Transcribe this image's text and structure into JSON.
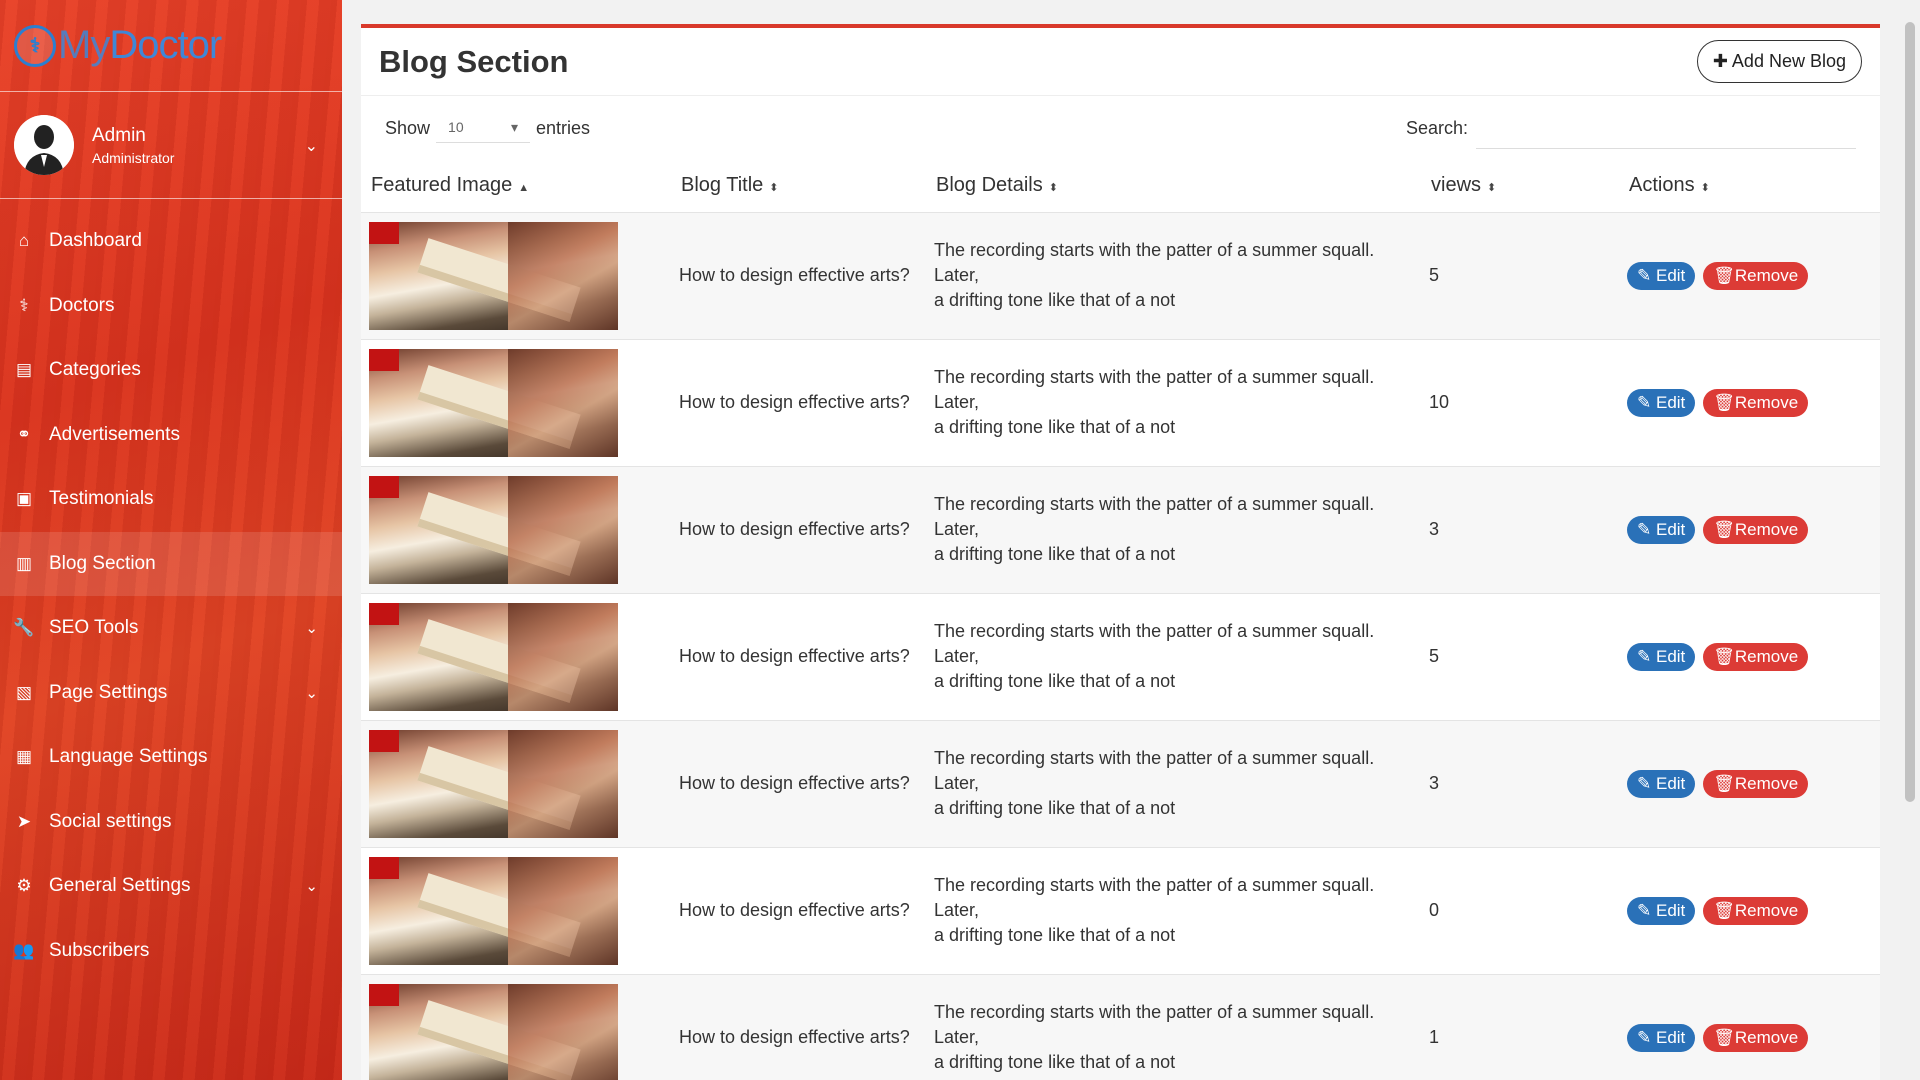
{
  "brand": {
    "logo_icon": "stethoscope-icon",
    "name_prefix": "My",
    "name_suffix": "Doctor"
  },
  "user": {
    "name": "Admin",
    "role": "Administrator"
  },
  "sidebar": {
    "items": [
      {
        "label": "Dashboard",
        "icon": "home-icon",
        "glyph": "⌂"
      },
      {
        "label": "Doctors",
        "icon": "user-md-icon",
        "glyph": "⚕"
      },
      {
        "label": "Categories",
        "icon": "list-alt-icon",
        "glyph": "▤"
      },
      {
        "label": "Advertisements",
        "icon": "link-icon",
        "glyph": "⚭"
      },
      {
        "label": "Testimonials",
        "icon": "image-icon",
        "glyph": "▣"
      },
      {
        "label": "Blog Section",
        "icon": "file-text-icon",
        "glyph": "▥"
      },
      {
        "label": "SEO Tools",
        "icon": "wrench-icon",
        "glyph": "🔧"
      },
      {
        "label": "Page Settings",
        "icon": "file-code-icon",
        "glyph": "▧"
      },
      {
        "label": "Language Settings",
        "icon": "language-icon",
        "glyph": "▦"
      },
      {
        "label": "Social settings",
        "icon": "paper-plane-icon",
        "glyph": "➤"
      },
      {
        "label": "General Settings",
        "icon": "cogs-icon",
        "glyph": "⚙"
      },
      {
        "label": "Subscribers",
        "icon": "users-icon",
        "glyph": "👥"
      }
    ]
  },
  "page": {
    "title": "Blog Section",
    "add_button": "Add New Blog"
  },
  "table_controls": {
    "show_label": "Show",
    "entries_value": "10",
    "entries_label": "entries",
    "search_label": "Search:"
  },
  "columns": [
    "Featured Image",
    "Blog Title",
    "Blog Details",
    "views",
    "Actions"
  ],
  "rows": [
    {
      "title": "How to design effective arts?",
      "details_line1": "The recording starts with the patter of a summer squall. Later,",
      "details_line2": "a drifting tone like that of a not",
      "views": "5",
      "edit": "Edit",
      "remove": "Remove"
    },
    {
      "title": "How to design effective arts?",
      "details_line1": "The recording starts with the patter of a summer squall. Later,",
      "details_line2": "a drifting tone like that of a not",
      "views": "10",
      "edit": "Edit",
      "remove": "Remove"
    },
    {
      "title": "How to design effective arts?",
      "details_line1": "The recording starts with the patter of a summer squall. Later,",
      "details_line2": "a drifting tone like that of a not",
      "views": "3",
      "edit": "Edit",
      "remove": "Remove"
    },
    {
      "title": "How to design effective arts?",
      "details_line1": "The recording starts with the patter of a summer squall. Later,",
      "details_line2": "a drifting tone like that of a not",
      "views": "5",
      "edit": "Edit",
      "remove": "Remove"
    },
    {
      "title": "How to design effective arts?",
      "details_line1": "The recording starts with the patter of a summer squall. Later,",
      "details_line2": "a drifting tone like that of a not",
      "views": "3",
      "edit": "Edit",
      "remove": "Remove"
    },
    {
      "title": "How to design effective arts?",
      "details_line1": "The recording starts with the patter of a summer squall. Later,",
      "details_line2": "a drifting tone like that of a not",
      "views": "0",
      "edit": "Edit",
      "remove": "Remove"
    },
    {
      "title": "How to design effective arts?",
      "details_line1": "The recording starts with the patter of a summer squall. Later,",
      "details_line2": "a drifting tone like that of a not",
      "views": "1",
      "edit": "Edit",
      "remove": "Remove"
    }
  ],
  "colors": {
    "accent": "#d9392b",
    "edit": "#2a71b8",
    "remove": "#dc3b36"
  }
}
